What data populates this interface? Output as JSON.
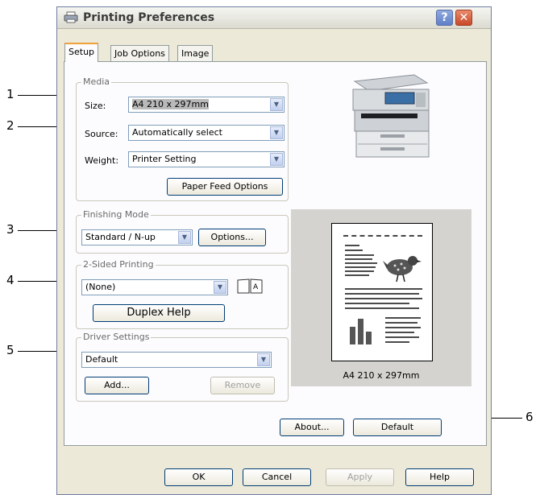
{
  "callouts": [
    "1",
    "2",
    "3",
    "4",
    "5",
    "6"
  ],
  "window": {
    "title": "Printing Preferences",
    "help_label": "?",
    "close_label": "✕"
  },
  "tabs": [
    {
      "label": "Setup",
      "active": true
    },
    {
      "label": "Job Options",
      "active": false
    },
    {
      "label": "Image",
      "active": false
    }
  ],
  "media": {
    "title": "Media",
    "size_label": "Size:",
    "size_value": "A4 210 x 297mm",
    "source_label": "Source:",
    "source_value": "Automatically select",
    "weight_label": "Weight:",
    "weight_value": "Printer Setting",
    "paper_feed_button": "Paper Feed Options"
  },
  "finishing": {
    "title": "Finishing Mode",
    "value": "Standard / N-up",
    "options_button": "Options..."
  },
  "duplex": {
    "title": "2-Sided Printing",
    "value": "(None)",
    "help_button": "Duplex Help"
  },
  "driver": {
    "title": "Driver Settings",
    "value": "Default",
    "add_button": "Add...",
    "remove_button": "Remove"
  },
  "preview": {
    "caption": "A4 210 x 297mm"
  },
  "buttons": {
    "about": "About...",
    "default": "Default",
    "ok": "OK",
    "cancel": "Cancel",
    "apply": "Apply",
    "help": "Help"
  },
  "icons": {
    "printer": "printer-icon",
    "book": "book-icon",
    "bird": "bird-image",
    "dropdown": "chevron-down-icon"
  },
  "colors": {
    "accent_tab": "#f0a33a",
    "close": "#c9482a",
    "help": "#5f7fc8"
  }
}
